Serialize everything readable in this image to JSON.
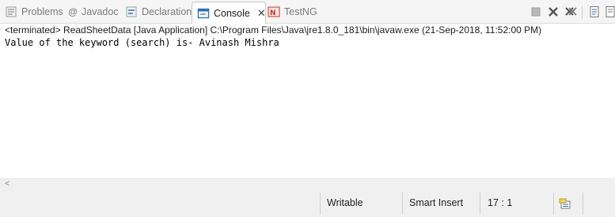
{
  "tabs": [
    {
      "label": "Problems",
      "icon": "problems-icon"
    },
    {
      "label": "Javadoc",
      "icon": "javadoc-icon"
    },
    {
      "label": "Declaration",
      "icon": "declaration-icon"
    },
    {
      "label": "Console",
      "icon": "console-icon",
      "active": true,
      "close": "✕"
    },
    {
      "label": "TestNG",
      "icon": "testng-icon"
    }
  ],
  "header": {
    "text": "<terminated> ReadSheetData [Java Application] C:\\Program Files\\Java\\jre1.8.0_181\\bin\\javaw.exe (21-Sep-2018, 11:52:00 PM)"
  },
  "console": {
    "lines": [
      "Value of the keyword (search) is- Avinash Mishra"
    ]
  },
  "scrollbar": {
    "left_arrow": "<"
  },
  "status": {
    "writable": "Writable",
    "insert_mode": "Smart Insert",
    "position": "17 : 1"
  },
  "colors": {
    "accent": "#2f6fb3",
    "terminate_red": "#b9b9b9",
    "testng_red": "#c0392b"
  }
}
